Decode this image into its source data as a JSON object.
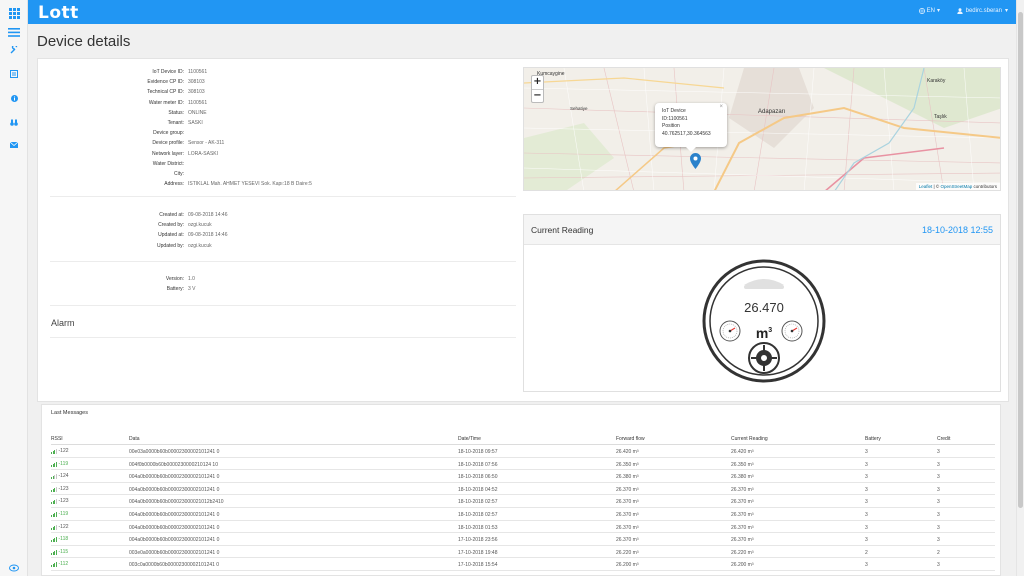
{
  "app": {
    "logo": "Lott"
  },
  "sidebar": {
    "items": [
      {
        "icon": "apps-grid-icon"
      },
      {
        "icon": "menu-icon"
      },
      {
        "icon": "wrench-icon"
      },
      {
        "icon": "list-icon"
      },
      {
        "icon": "info-icon"
      },
      {
        "icon": "binoculars-icon"
      },
      {
        "icon": "mail-icon"
      }
    ],
    "footer_icon": "settings-icon"
  },
  "header": {
    "language": "EN",
    "username": "bedirc.sberan"
  },
  "page": {
    "title": "Device details"
  },
  "device": {
    "fields": [
      {
        "label": "IoT Device ID:",
        "value": "1100561"
      },
      {
        "label": "Evidence CP ID:",
        "value": "308103"
      },
      {
        "label": "Technical CP ID:",
        "value": "308103"
      },
      {
        "label": "Water meter ID:",
        "value": "1100561"
      },
      {
        "label": "Status:",
        "value": "ONLINE"
      },
      {
        "label": "Tenant:",
        "value": "SASKI"
      },
      {
        "label": "Device group:",
        "value": ""
      },
      {
        "label": "Device profile:",
        "value": "Sensor - AK-311"
      },
      {
        "label": "Network layer:",
        "value": "LORA-SASKI"
      },
      {
        "label": "Water District:",
        "value": ""
      },
      {
        "label": "City:",
        "value": ""
      },
      {
        "label": "Address:",
        "value": "ISTIKLAL Mah. AHMET YESEVI Sok. Kapı:18 B Daire:5"
      }
    ],
    "audit": [
      {
        "label": "Created at:",
        "value": "09-08-2018 14:46"
      },
      {
        "label": "Created by:",
        "value": "ozgi.kucuk"
      },
      {
        "label": "Updated at:",
        "value": "09-08-2018 14:46"
      },
      {
        "label": "Updated by:",
        "value": "ozgi.kucuk"
      }
    ],
    "info": [
      {
        "label": "Version:",
        "value": "1.0"
      },
      {
        "label": "Battery:",
        "value": "3 V"
      }
    ],
    "alarm_label": "Alarm"
  },
  "map": {
    "zoom_in": "+",
    "zoom_out": "−",
    "places": [
      "Kumcaygine",
      "Adapazarı",
      "Karaköy",
      "Taşlık",
      "Sehatiye"
    ],
    "popup": {
      "title": "IoT Device",
      "id": "ID:1100561",
      "position_label": "Position",
      "position": "40.762517,30.364563",
      "close": "×"
    },
    "attribution": {
      "leaflet": "Leaflet",
      "sep": " | © ",
      "osm": "OpenStreetMap",
      "suffix": " contributors"
    }
  },
  "current_reading": {
    "title": "Current Reading",
    "timestamp": "18-10-2018 12:55",
    "value": "26.470",
    "unit": "m",
    "unit_exp": "3",
    "accent": "#2196f3"
  },
  "messages": {
    "title": "Last Messages",
    "columns": [
      "RSSI",
      "Data",
      "Date/Time",
      "Forward flow",
      "Current Reading",
      "Battery",
      "Credit"
    ],
    "rows": [
      {
        "rssi": "-122",
        "data": "00e03a0000b60b00002300002101241 0",
        "dt": "18-10-2018 09:57",
        "flow": "26.420 m³",
        "reading": "26.420 m³",
        "battery": "3",
        "credit": "3"
      },
      {
        "rssi": "-119",
        "data": "004f0b0000b60b0000230000210124 10",
        "dt": "18-10-2018 07:56",
        "flow": "26.350 m³",
        "reading": "26.350 m³",
        "battery": "3",
        "credit": "3"
      },
      {
        "rssi": "-124",
        "data": "004a0b0000b60b00002300002101241 0",
        "dt": "18-10-2018 06:50",
        "flow": "26.380 m³",
        "reading": "26.380 m³",
        "battery": "3",
        "credit": "3"
      },
      {
        "rssi": "-123",
        "data": "004a0b0000b60b00002300002101241 0",
        "dt": "18-10-2018 04:52",
        "flow": "26.370 m³",
        "reading": "26.370 m³",
        "battery": "3",
        "credit": "3"
      },
      {
        "rssi": "-123",
        "data": "004a0b0000b60b000023000021012b2410",
        "dt": "18-10-2018 02:57",
        "flow": "26.370 m³",
        "reading": "26.370 m³",
        "battery": "3",
        "credit": "3"
      },
      {
        "rssi": "-119",
        "data": "004a0b0000b60b00002300002101241 0",
        "dt": "18-10-2018 02:57",
        "flow": "26.370 m³",
        "reading": "26.370 m³",
        "battery": "3",
        "credit": "3"
      },
      {
        "rssi": "-122",
        "data": "004a0b0000b60b00002300002101241 0",
        "dt": "18-10-2018 01:53",
        "flow": "26.370 m³",
        "reading": "26.370 m³",
        "battery": "3",
        "credit": "3"
      },
      {
        "rssi": "-118",
        "data": "004a0b0000b60b00002300002101241 0",
        "dt": "17-10-2018 23:56",
        "flow": "26.370 m³",
        "reading": "26.370 m³",
        "battery": "3",
        "credit": "3"
      },
      {
        "rssi": "-115",
        "data": "003e0a0000b60b00002300002101241 0",
        "dt": "17-10-2018 19:48",
        "flow": "26.220 m³",
        "reading": "26.220 m³",
        "battery": "2",
        "credit": "2"
      },
      {
        "rssi": "-112",
        "data": "003c0a0000b60b00002300002101241 0",
        "dt": "17-10-2018 15:54",
        "flow": "26.200 m³",
        "reading": "26.200 m³",
        "battery": "3",
        "credit": "3"
      }
    ]
  }
}
